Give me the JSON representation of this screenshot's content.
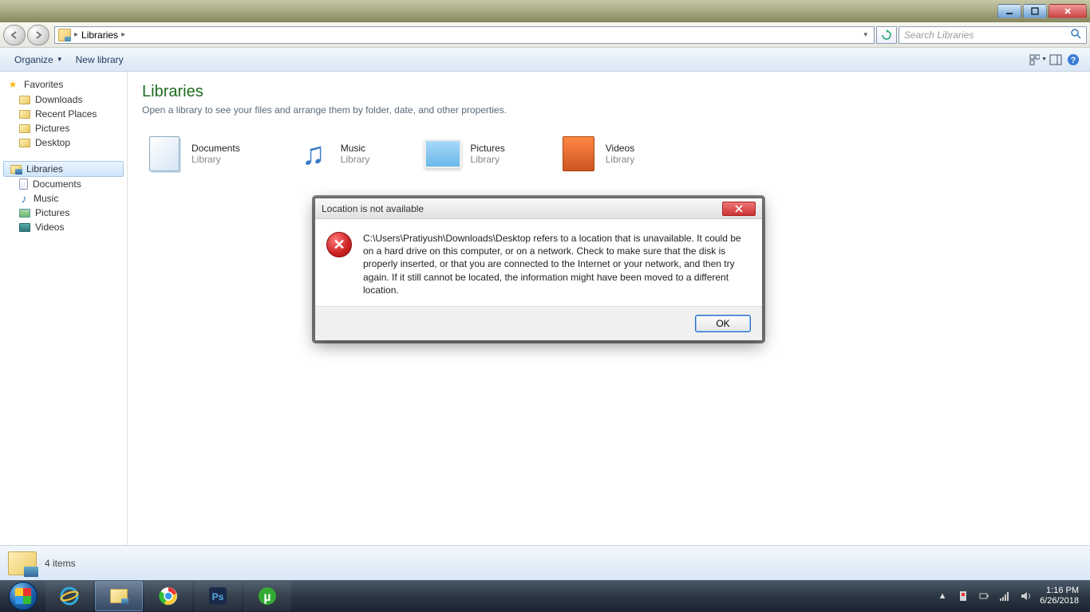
{
  "titlebar": {
    "min": "_",
    "max": "❐",
    "close": "✕"
  },
  "navbar": {
    "breadcrumb_root": "Libraries",
    "breadcrumb_sep": "▸",
    "search_placeholder": "Search Libraries"
  },
  "toolbar": {
    "organize": "Organize",
    "newlib": "New library"
  },
  "sidebar": {
    "favorites": {
      "head": "Favorites",
      "items": [
        "Downloads",
        "Recent Places",
        "Pictures",
        "Desktop"
      ]
    },
    "libraries": {
      "head": "Libraries",
      "items": [
        "Documents",
        "Music",
        "Pictures",
        "Videos"
      ]
    }
  },
  "main": {
    "title": "Libraries",
    "subtitle": "Open a library to see your files and arrange them by folder, date, and other properties.",
    "items": [
      {
        "name": "Documents",
        "type": "Library"
      },
      {
        "name": "Music",
        "type": "Library"
      },
      {
        "name": "Pictures",
        "type": "Library"
      },
      {
        "name": "Videos",
        "type": "Library"
      }
    ]
  },
  "status": {
    "text": "4 items"
  },
  "dialog": {
    "title": "Location is not available",
    "message": "C:\\Users\\Pratiyush\\Downloads\\Desktop refers to a location that is unavailable. It could be on a hard drive on this computer, or on a network. Check to make sure that the disk is properly inserted, or that you are connected to the Internet or your network, and then try again. If it still cannot be located, the information might have been moved to a different location.",
    "ok": "OK",
    "icon": "✕"
  },
  "tray": {
    "time": "1:16 PM",
    "date": "6/26/2018",
    "up": "▲"
  }
}
